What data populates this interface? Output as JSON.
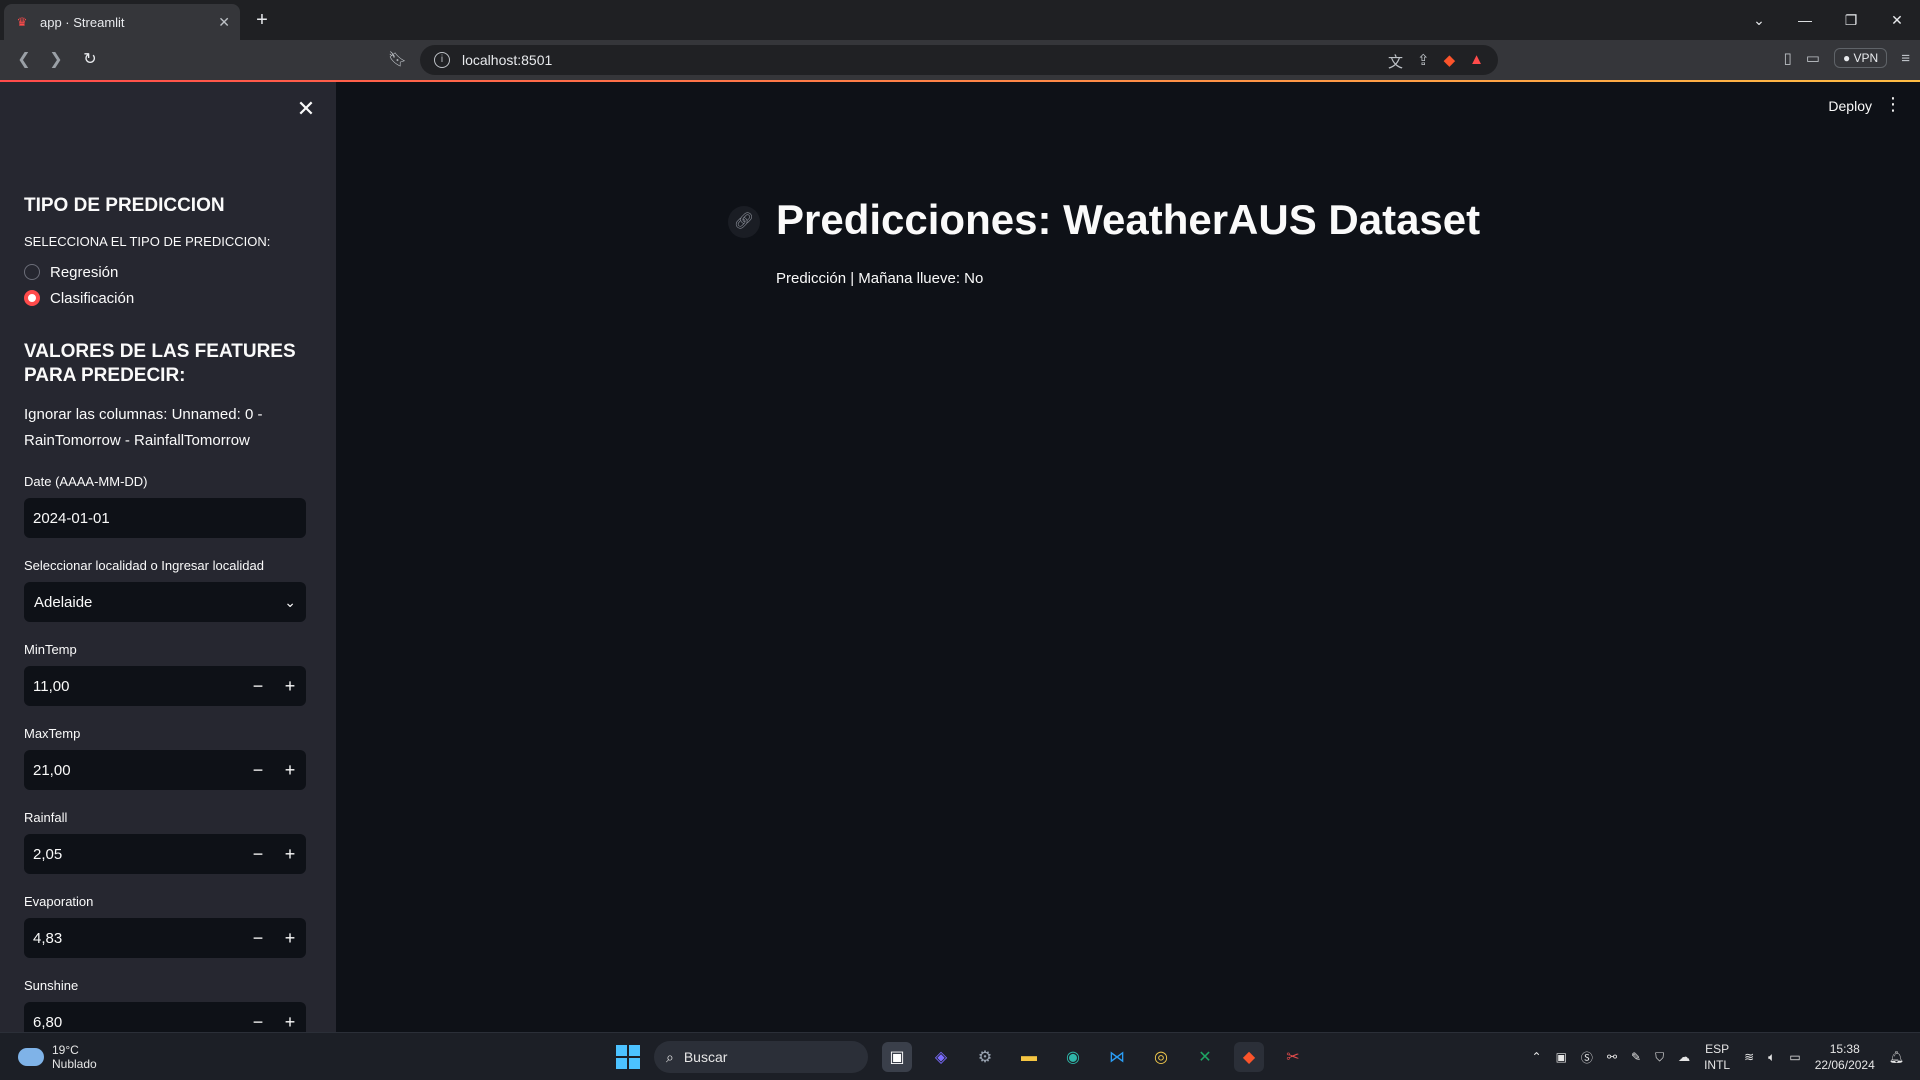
{
  "browser": {
    "tab_title": "app · Streamlit",
    "url": "localhost:8501",
    "vpn_label": "VPN"
  },
  "sidebar": {
    "section1_title": "TIPO DE PREDICCION",
    "radio_label": "SELECCIONA EL TIPO DE PREDICCION:",
    "radio_options": [
      {
        "label": "Regresión",
        "selected": false
      },
      {
        "label": "Clasificación",
        "selected": true
      }
    ],
    "section2_title": "VALORES DE LAS FEATURES PARA PREDECIR:",
    "note": "Ignorar las columnas: Unnamed: 0 - RainTomorrow - RainfallTomorrow",
    "date": {
      "label": "Date (AAAA-MM-DD)",
      "value": "2024-01-01"
    },
    "location": {
      "label": "Seleccionar localidad o Ingresar localidad",
      "value": "Adelaide"
    },
    "numbers": [
      {
        "label": "MinTemp",
        "value": "11,00"
      },
      {
        "label": "MaxTemp",
        "value": "21,00"
      },
      {
        "label": "Rainfall",
        "value": "2,05"
      },
      {
        "label": "Evaporation",
        "value": "4,83"
      },
      {
        "label": "Sunshine",
        "value": "6,80"
      }
    ]
  },
  "main": {
    "deploy_label": "Deploy",
    "title": "Predicciones: WeatherAUS Dataset",
    "result": "Predicción | Mañana llueve: No"
  },
  "taskbar": {
    "weather_temp": "19°C",
    "weather_desc": "Nublado",
    "search_placeholder": "Buscar",
    "lang_line1": "ESP",
    "lang_line2": "INTL",
    "time": "15:38",
    "date": "22/06/2024"
  },
  "colors": {
    "accent": "#ff4b4b",
    "background": "#0e1117",
    "sidebar": "#262730"
  }
}
